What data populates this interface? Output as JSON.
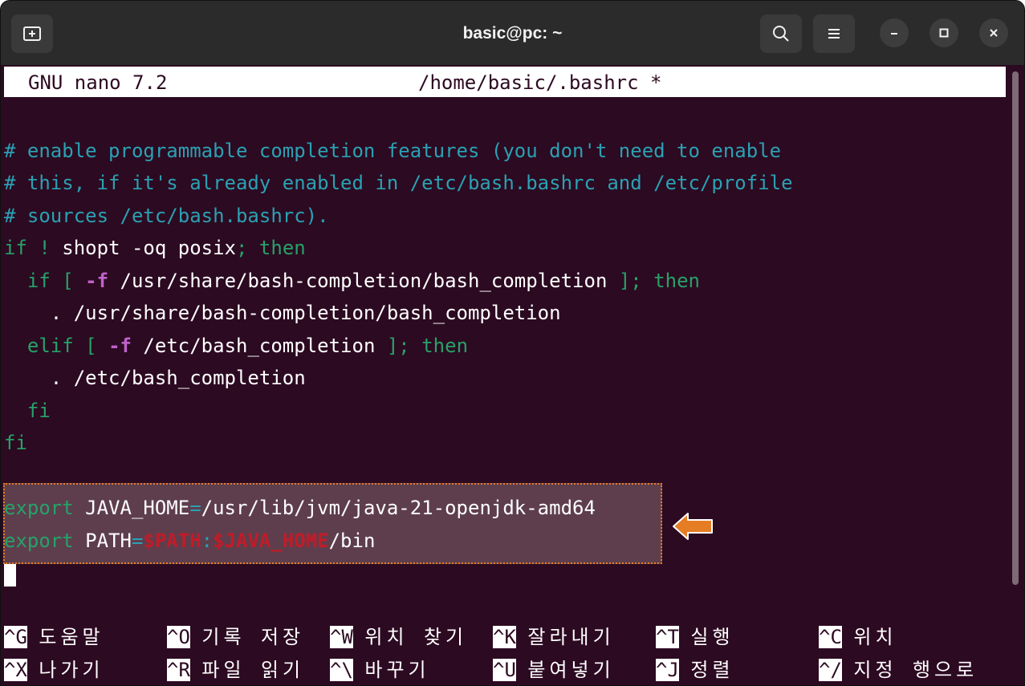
{
  "window": {
    "title": "basic@pc: ~",
    "icons": [
      "new-tab-icon",
      "search-icon",
      "menu-icon",
      "minimize-icon",
      "maximize-icon",
      "close-icon"
    ]
  },
  "nano": {
    "version": "GNU nano 7.2",
    "filename": "/home/basic/.bashrc *"
  },
  "code": {
    "c1": "# enable programmable completion features (you don't need to enable",
    "c2": "# this, if it's already enabled in /etc/bash.bashrc and /etc/profile",
    "c3": "# sources /etc/bash.bashrc).",
    "l4": {
      "if": "if",
      "bang": " ! ",
      "rest": "shopt -oq posix",
      "semi": ";",
      "then": " then"
    },
    "l5": {
      "indent": "  ",
      "if": "if",
      "br": " [ ",
      "flag": "-f",
      "path": " /usr/share/bash-completion/bash_completion ",
      "end": "];",
      "then": " then"
    },
    "l6": "    . /usr/share/bash-completion/bash_completion",
    "l7": {
      "indent": "  ",
      "elif": "elif",
      "br": " [ ",
      "flag": "-f",
      "path": " /etc/bash_completion ",
      "end": "];",
      "then": " then"
    },
    "l8": "    . /etc/bash_completion",
    "l9": "  fi",
    "l10": "fi",
    "e1": {
      "export": "export",
      "name": " JAVA_HOME",
      "eq": "=",
      "value": "/usr/lib/jvm/java-21-openjdk-amd64"
    },
    "e2": {
      "export": "export",
      "name": " PATH",
      "eq": "=",
      "v1": "$PATH",
      "colon": ":",
      "v2": "$JAVA_HOME",
      "tail": "/bin"
    }
  },
  "shortcuts": [
    {
      "key": "^G",
      "label": "도움말"
    },
    {
      "key": "^O",
      "label": "기록 저장"
    },
    {
      "key": "^W",
      "label": "위치 찾기"
    },
    {
      "key": "^K",
      "label": "잘라내기"
    },
    {
      "key": "^T",
      "label": "실행"
    },
    {
      "key": "^C",
      "label": "위치"
    },
    {
      "key": "^X",
      "label": "나가기"
    },
    {
      "key": "^R",
      "label": "파일 읽기"
    },
    {
      "key": "^\\",
      "label": "바꾸기"
    },
    {
      "key": "^U",
      "label": "붙여넣기"
    },
    {
      "key": "^J",
      "label": "정렬"
    },
    {
      "key": "^/",
      "label": "지정 행으로"
    }
  ],
  "colors": {
    "background": "#2c0a21",
    "comment": "#2aa1b3",
    "keyword": "#26a269",
    "variable": "#c01c28",
    "highlight_border": "#e57d24"
  }
}
